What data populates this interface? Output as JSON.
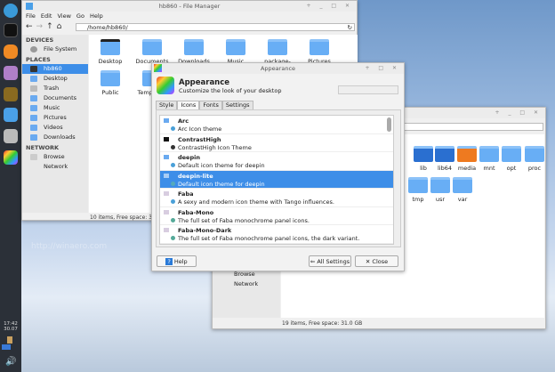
{
  "taskbar": {
    "clock_time": "17:42",
    "clock_date": "30.07"
  },
  "fm1": {
    "title": "hb860 - File Manager",
    "menu": [
      "File",
      "Edit",
      "View",
      "Go",
      "Help"
    ],
    "path": "/home/hb860/",
    "sidebar": {
      "devices_header": "DEVICES",
      "devices": [
        "File System"
      ],
      "places_header": "PLACES",
      "places": [
        "hb860",
        "Desktop",
        "Trash",
        "Documents",
        "Music",
        "Pictures",
        "Videos",
        "Downloads"
      ],
      "network_header": "NETWORK",
      "network": [
        "Browse Network"
      ]
    },
    "files": [
      "Desktop",
      "Documents",
      "Downloads",
      "Music",
      "package-query",
      "Pictures",
      "Public",
      "Templates"
    ],
    "status": "10 items, Free space: 31"
  },
  "fm2": {
    "files": [
      "lib",
      "lib64",
      "media",
      "mnt",
      "opt",
      "proc",
      "tmp",
      "usr",
      "var"
    ],
    "network": "Browse Network",
    "status": "19 items, Free space: 31.0 GB"
  },
  "appearance": {
    "title": "Appearance",
    "heading": "Appearance",
    "subtitle": "Customize the look of your desktop",
    "search_placeholder": "",
    "tabs": [
      "Style",
      "Icons",
      "Fonts",
      "Settings"
    ],
    "active_tab": "Icons",
    "themes": [
      {
        "name": "Arc",
        "desc": "Arc Icon theme"
      },
      {
        "name": "ContrastHigh",
        "desc": "ContrastHigh Icon Theme"
      },
      {
        "name": "deepin",
        "desc": "Default icon theme for deepin"
      },
      {
        "name": "deepin-lite",
        "desc": "Default icon theme for deepin",
        "selected": true
      },
      {
        "name": "Faba",
        "desc": "A sexy and modern icon theme with Tango influences."
      },
      {
        "name": "Faba-Mono",
        "desc": "The full set of Faba monochrome panel icons."
      },
      {
        "name": "Faba-Mono-Dark",
        "desc": "The full set of Faba monochrome panel icons, the dark variant."
      }
    ],
    "help_label": "Help",
    "all_settings_label": "All Settings",
    "close_label": "Close"
  },
  "watermark": "http://winaero.com"
}
